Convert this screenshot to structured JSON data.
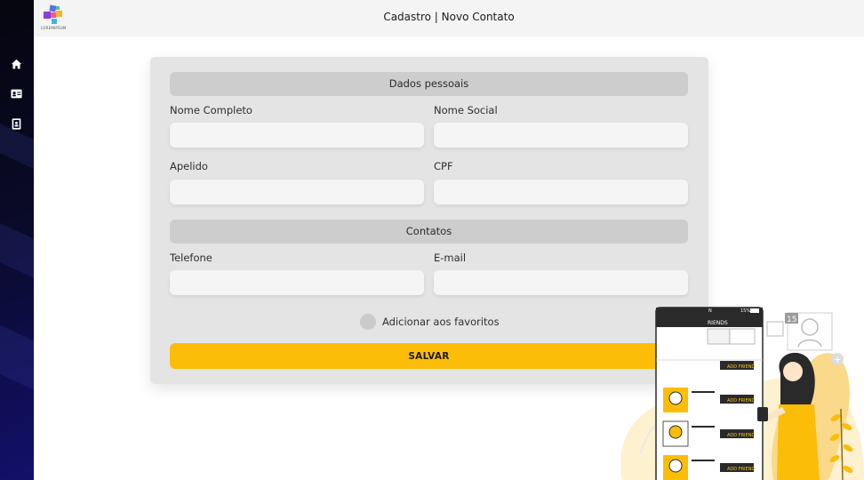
{
  "header": {
    "title": "Cadastro | Novo Contato",
    "logo_text": "LOREMIPSUM"
  },
  "sidebar": {
    "items": [
      {
        "icon": "home-icon"
      },
      {
        "icon": "contact-card-icon"
      },
      {
        "icon": "address-book-icon"
      }
    ]
  },
  "form": {
    "personal_section": "Dados pessoais",
    "full_name_label": "Nome Completo",
    "social_name_label": "Nome Social",
    "nickname_label": "Apelido",
    "cpf_label": "CPF",
    "full_name_value": "",
    "social_name_value": "",
    "nickname_value": "",
    "cpf_value": "",
    "contacts_section": "Contatos",
    "phone_label": "Telefone",
    "email_label": "E-mail",
    "phone_value": "",
    "email_value": "",
    "favorite_label": "Adicionar aos favoritos",
    "save_label": "SALVAR"
  },
  "illustration": {
    "phone_header": "RIENDS",
    "phone_status_left": "N",
    "phone_status_right": "15%",
    "add_friend_label": "ADD FRIEND",
    "badge_count": "15"
  },
  "colors": {
    "accent": "#fbbd08",
    "card_bg": "#e4e4e4",
    "section_header": "#cdcdcd",
    "sidebar_dark": "#0a0a28"
  }
}
